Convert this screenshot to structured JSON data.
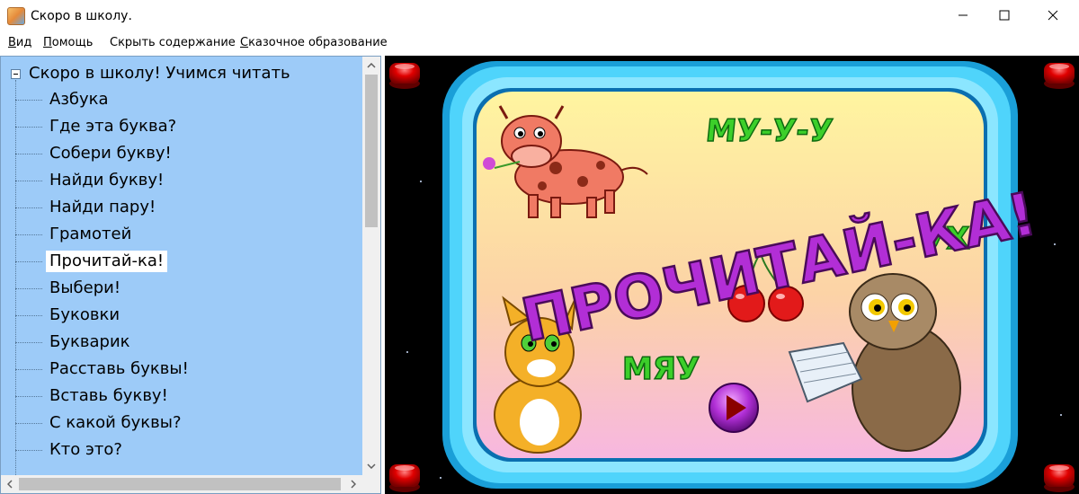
{
  "window": {
    "title": "Скоро в школу.",
    "icon": "app-icon"
  },
  "menu": [
    {
      "label": "Вид",
      "accel": "В",
      "rest": "ид"
    },
    {
      "label": "Помощь",
      "accel": "П",
      "rest": "омощь"
    },
    {
      "label": "Скрыть содержание",
      "accel": "",
      "rest": "Скрыть содержание"
    },
    {
      "label": "Сказочное образование",
      "accel": "С",
      "rest": "казочное образование"
    }
  ],
  "tree": {
    "root_label": "Скоро в школу! Учимся читать",
    "items": [
      {
        "label": "Азбука"
      },
      {
        "label": "Где эта буква?"
      },
      {
        "label": "Собери букву!"
      },
      {
        "label": "Найди букву!"
      },
      {
        "label": "Найди пару!"
      },
      {
        "label": "Грамотей"
      },
      {
        "label": "Прочитай-ка!",
        "selected": true
      },
      {
        "label": "Выбери!"
      },
      {
        "label": "Буковки"
      },
      {
        "label": "Букварик"
      },
      {
        "label": "Расставь буквы!"
      },
      {
        "label": "Вставь букву!"
      },
      {
        "label": "С какой буквы?"
      },
      {
        "label": "Кто это?"
      }
    ]
  },
  "scene": {
    "title": "ПРОЧИТАЙ-КА!",
    "cow_sound": "МУ-У-У",
    "owl_sound": "УХ",
    "cat_sound": "МЯУ",
    "play_button": "play-icon"
  },
  "colors": {
    "sidebar_bg": "#9dcbf8",
    "frame_cyan": "#35c8f5",
    "title_purple": "#b22ed6",
    "sound_green": "#3ccf2a",
    "red_button": "#d40000"
  }
}
